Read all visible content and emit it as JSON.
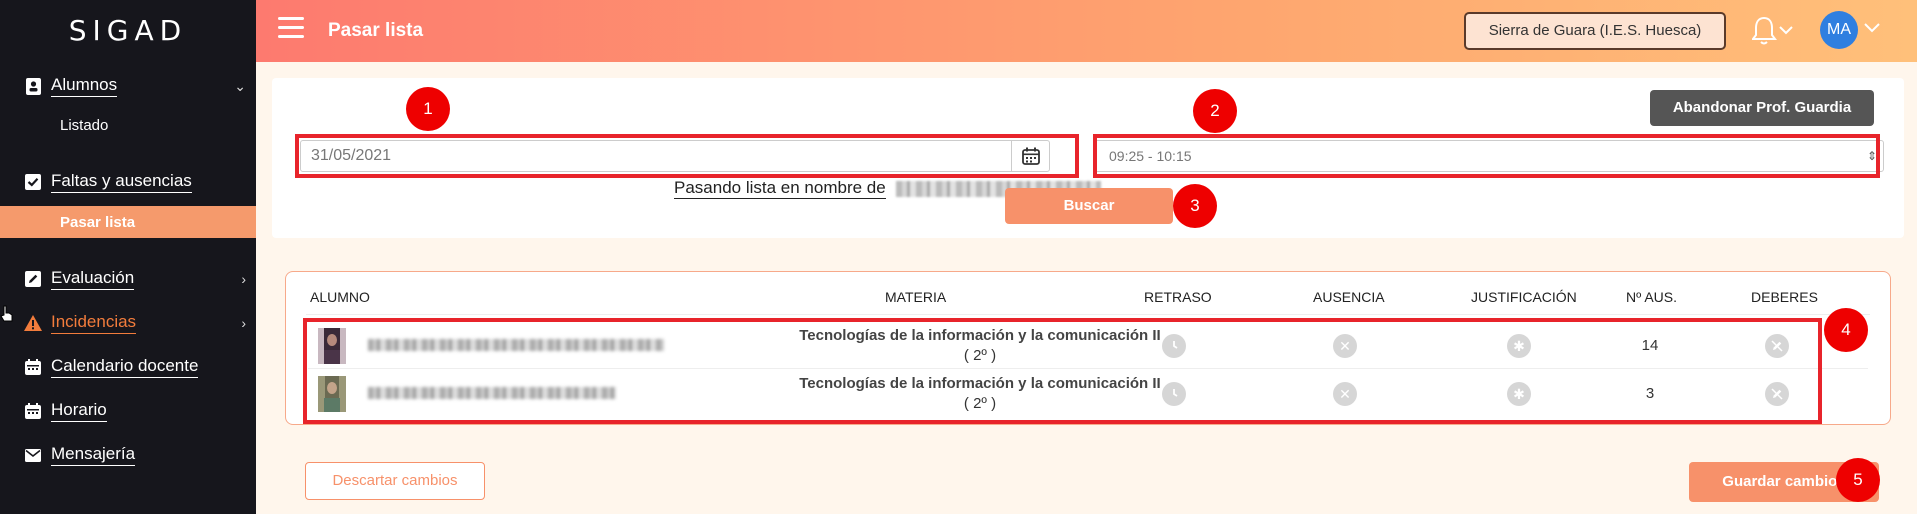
{
  "app": {
    "logo": "SIGAD"
  },
  "sidebar": {
    "items": [
      {
        "label": "Alumnos",
        "icon": "student-icon"
      },
      {
        "label": "Listado"
      },
      {
        "label": "Faltas y ausencias",
        "icon": "checkbox-icon"
      },
      {
        "label": "Pasar lista"
      },
      {
        "label": "Evaluación",
        "icon": "edit-icon"
      },
      {
        "label": "Incidencias",
        "icon": "warning-icon"
      },
      {
        "label": "Calendario docente",
        "icon": "calendar-icon"
      },
      {
        "label": "Horario",
        "icon": "calendar-icon"
      },
      {
        "label": "Mensajería",
        "icon": "mail-icon"
      }
    ]
  },
  "header": {
    "title": "Pasar lista",
    "center_button": "Sierra de Guara (I.E.S. Huesca)",
    "avatar_initials": "MA"
  },
  "form": {
    "on_behalf_label": "Pasando lista en nombre de",
    "abandon_button": "Abandonar Prof. Guardia",
    "date_value": "31/05/2021",
    "time_value": "09:25 - 10:15",
    "search_button": "Buscar"
  },
  "table": {
    "headers": [
      "ALUMNO",
      "MATERIA",
      "RETRASO",
      "AUSENCIA",
      "JUSTIFICACIÓN",
      "Nº AUS.",
      "DEBERES"
    ],
    "rows": [
      {
        "materia": "Tecnologías de la información y la comunicación II",
        "nivel": "( 2º )",
        "n_aus": "14"
      },
      {
        "materia": "Tecnologías de la información y la comunicación II",
        "nivel": "( 2º )",
        "n_aus": "3"
      }
    ]
  },
  "footer": {
    "discard_button": "Descartar cambios",
    "save_button": "Guardar cambios"
  },
  "annotations": [
    "1",
    "2",
    "3",
    "4",
    "5"
  ],
  "colors": {
    "accent": "#f7916a",
    "annotation_red": "#e00000",
    "sidebar_bg": "#16161c",
    "warning": "#f27c3c"
  }
}
